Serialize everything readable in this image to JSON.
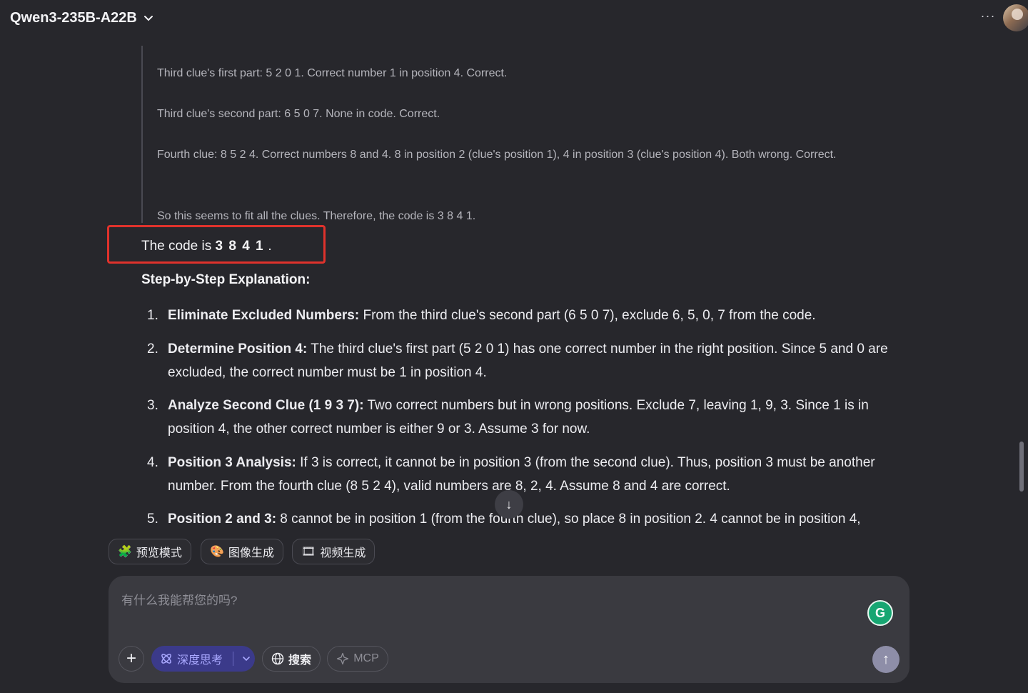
{
  "header": {
    "model_name": "Qwen3-235B-A22B",
    "more_label": "···"
  },
  "thinking": [
    "Third clue's first part: 5 2 0 1. Correct number 1 in position 4. Correct.",
    "Third clue's second part: 6 5 0 7. None in code. Correct.",
    "Fourth clue: 8 5 2 4. Correct numbers 8 and 4. 8 in position 2 (clue's position 1), 4 in position 3 (clue's position 4). Both wrong. Correct.",
    "So this seems to fit all the clues. Therefore, the code is 3 8 4 1."
  ],
  "answer": {
    "prefix": "The code is ",
    "code": "3 8 4 1",
    "suffix": " ."
  },
  "steps_title": "Step-by-Step Explanation:",
  "steps": [
    {
      "num": "1.",
      "title": "Eliminate Excluded Numbers:",
      "text": " From the third clue's second part (6 5 0 7), exclude 6, 5, 0, 7 from the code."
    },
    {
      "num": "2.",
      "title": "Determine Position 4:",
      "text": " The third clue's first part (5 2 0 1) has one correct number in the right position. Since 5 and 0 are excluded, the correct number must be 1 in position 4."
    },
    {
      "num": "3.",
      "title": "Analyze Second Clue (1 9 3 7):",
      "text": " Two correct numbers but in wrong positions. Exclude 7, leaving 1, 9, 3. Since 1 is in position 4, the other correct number is either 9 or 3. Assume 3 for now."
    },
    {
      "num": "4.",
      "title": "Position 3 Analysis:",
      "text": " If 3 is correct, it cannot be in position 3 (from the second clue). Thus, position 3 must be another number. From the fourth clue (8 5 2 4), valid numbers are 8, 2, 4. Assume 8 and 4 are correct."
    },
    {
      "num": "5.",
      "title": "Position 2 and 3:",
      "text": " 8 cannot be in position 1 (from the fourth clue), so place 8 in position 2. 4 cannot be in position 4,"
    }
  ],
  "chips": [
    {
      "icon": "🧩",
      "label": "预览模式"
    },
    {
      "icon": "🎨",
      "label": "图像生成"
    },
    {
      "icon": "🎞",
      "label": "视频生成"
    }
  ],
  "composer": {
    "placeholder": "有什么我能帮您的吗?",
    "deep_think_label": "深度思考",
    "search_label": "搜索",
    "mcp_label": "MCP"
  },
  "colors": {
    "background": "#27272c",
    "highlight_border": "#e0322c",
    "deep_think_bg": "#3b3a8a",
    "grammarly": "#17a672"
  }
}
